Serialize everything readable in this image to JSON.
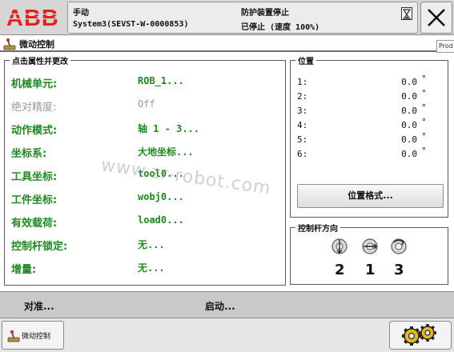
{
  "header": {
    "logo_text": "ABB",
    "mode": "手动",
    "system": "System3(SEVST-W-0000853)",
    "guard_status": "防护装置停止",
    "run_status": "已停止 (速度 100%)"
  },
  "window": {
    "title": "微动控制",
    "side_tab": "Prod"
  },
  "properties": {
    "legend": "点击属性并更改",
    "rows": [
      {
        "label": "机械单元:",
        "value": "ROB_1..."
      },
      {
        "label": "绝对精度:",
        "value": "Off"
      },
      {
        "label": "动作模式:",
        "value": "轴 1 - 3..."
      },
      {
        "label": "坐标系:",
        "value": "大地坐标..."
      },
      {
        "label": "工具坐标:",
        "value": "tool0..."
      },
      {
        "label": "工件坐标:",
        "value": "wobj0..."
      },
      {
        "label": "有效载荷:",
        "value": "load0..."
      },
      {
        "label": "控制杆锁定:",
        "value": "无..."
      },
      {
        "label": "增量:",
        "value": "无..."
      }
    ]
  },
  "position": {
    "legend": "位置",
    "rows": [
      {
        "axis": "1:",
        "value": "0.0",
        "unit": "°"
      },
      {
        "axis": "2:",
        "value": "0.0",
        "unit": "°"
      },
      {
        "axis": "3:",
        "value": "0.0",
        "unit": "°"
      },
      {
        "axis": "4:",
        "value": "0.0",
        "unit": "°"
      },
      {
        "axis": "5:",
        "value": "0.0",
        "unit": "°"
      },
      {
        "axis": "6:",
        "value": "0.0",
        "unit": "°"
      }
    ],
    "format_button": "位置格式..."
  },
  "joystick": {
    "legend": "控制杆方向",
    "axes": [
      {
        "number": "2",
        "icon": "joystick-updown-icon"
      },
      {
        "number": "1",
        "icon": "joystick-leftright-icon"
      },
      {
        "number": "3",
        "icon": "joystick-rotate-icon"
      }
    ]
  },
  "actions": {
    "align": "对准...",
    "start": "启动..."
  },
  "taskbar": {
    "jog_label": "微动控制",
    "quickset_icon": "gears-icon"
  },
  "watermark": "www.zr-robot.com",
  "colors": {
    "value_green": "#1f8a1f",
    "disabled_gray": "#9a9a9a",
    "abb_red": "#e2231a"
  }
}
